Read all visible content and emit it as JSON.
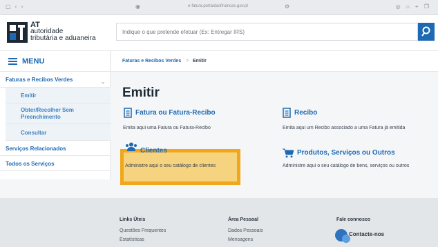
{
  "browser": {
    "nav_icons": "▢ ‹ ›",
    "url": "e-fatura.portaldasfinancas.gov.pt",
    "right_icons": "◎ ⌂ + ❐"
  },
  "header": {
    "logo_line1": "AT",
    "logo_line2": "autoridade",
    "logo_line3": "tributária e aduaneira",
    "search_placeholder": "Indique o que pretende efetuar (Ex: Entregar IRS)"
  },
  "sidebar": {
    "menu_label": "MENU",
    "items": [
      {
        "label": "Faturas e Recibos Verdes"
      },
      {
        "label": "Emitir"
      },
      {
        "label": "Obter/Recolher Sem Preenchimento"
      },
      {
        "label": "Consultar"
      },
      {
        "label": "Serviços Relacionados"
      },
      {
        "label": "Todos os Serviços"
      }
    ]
  },
  "breadcrumb": {
    "parent": "Faturas e Recibos Verdes",
    "separator": ">",
    "current": "Emitir"
  },
  "main": {
    "title": "Emitir",
    "cards": [
      {
        "title": "Fatura ou Fatura-Recibo",
        "desc": "Emita aqui uma Fatura ou Fatura-Recibo",
        "icon": "document-icon"
      },
      {
        "title": "Recibo",
        "desc": "Emita aqui um Recibo associado a uma Fatura já emitida",
        "icon": "document-icon"
      },
      {
        "title": "Clientes",
        "desc": "Administre aqui o seu catálogo de clientes",
        "icon": "people-icon"
      },
      {
        "title": "Produtos, Serviços ou Outros",
        "desc": "Administre aqui o seu catálogo de bens, serviços ou outros",
        "icon": "cart-icon"
      }
    ]
  },
  "footer": {
    "col1": {
      "heading": "Links Úteis",
      "links": [
        "Questões Frequentes",
        "Estatísticas"
      ]
    },
    "col2": {
      "heading": "Área Pessoal",
      "links": [
        "Dados Pessoais",
        "Mensagens"
      ]
    },
    "col3": {
      "heading": "Fale connosco",
      "contact_label": "Contacte-nos"
    }
  },
  "colors": {
    "brand_blue": "#1e69b3",
    "highlight_border": "#f1a71b",
    "highlight_fill": "#f6d37e"
  }
}
